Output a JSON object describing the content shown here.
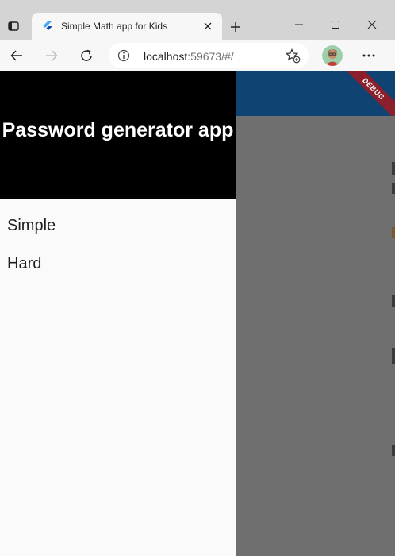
{
  "browser": {
    "tab": {
      "title": "Simple Math app for Kids",
      "favicon": "flutter-icon"
    },
    "address": {
      "host": "localhost",
      "port_path": ":59673/#/"
    },
    "icons": {
      "tab_actions": "tab-actions-icon",
      "tab_close": "close-icon",
      "new_tab": "plus-icon",
      "minimize": "minimize-icon",
      "maximize": "maximize-icon",
      "window_close": "close-icon",
      "back": "arrow-left-icon",
      "forward": "arrow-right-icon",
      "reload": "reload-icon",
      "site_info": "info-icon",
      "favorites": "favorites-add-icon",
      "profile": "avatar",
      "more": "more-icon"
    }
  },
  "app": {
    "appbar_color": "#0f4472",
    "debug_banner": "DEBUG",
    "drawer": {
      "header": "Password generator app",
      "items": [
        {
          "label": "Simple"
        },
        {
          "label": "Hard"
        }
      ]
    }
  }
}
